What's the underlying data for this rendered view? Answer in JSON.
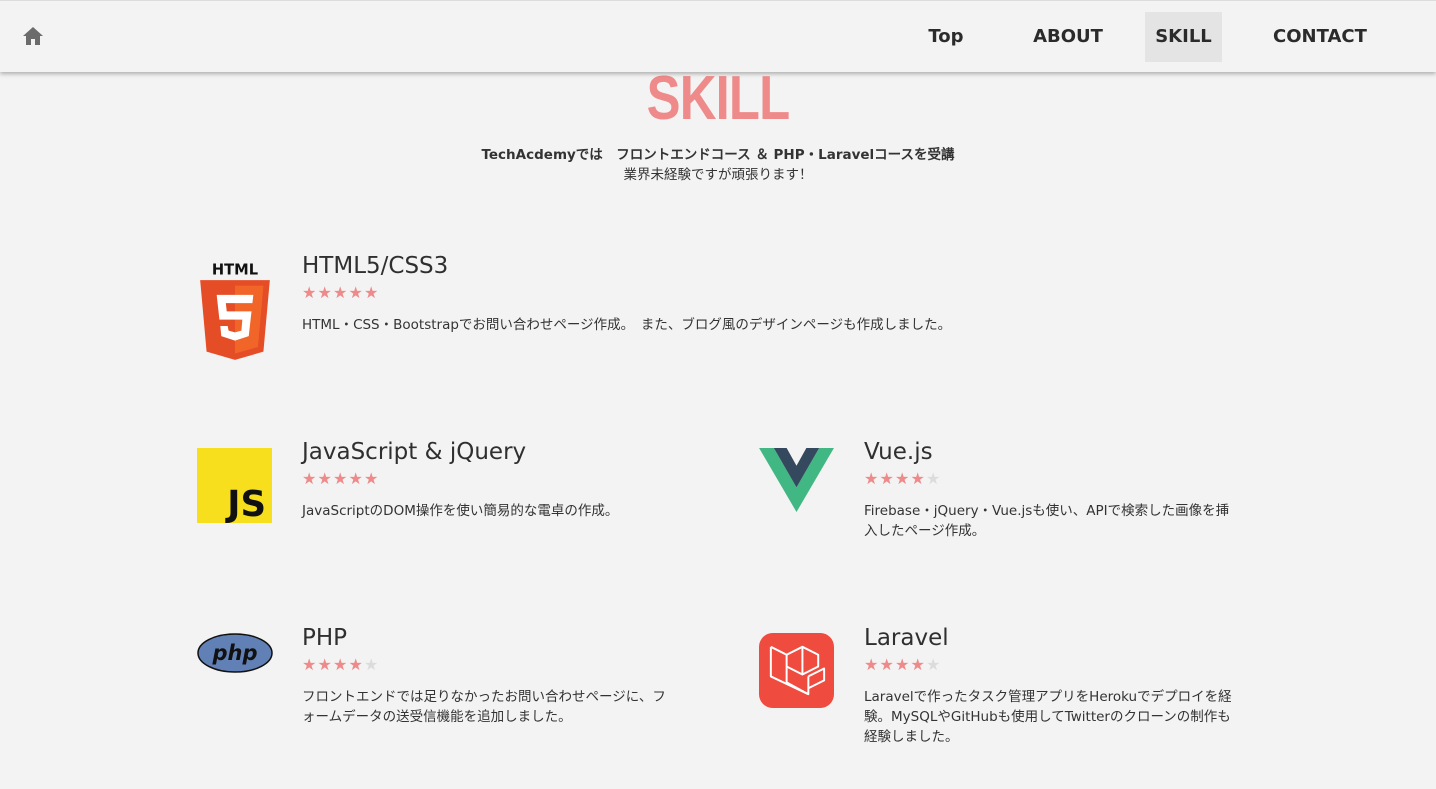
{
  "header": {
    "home_icon": "home-icon",
    "nav": [
      {
        "label": "Top",
        "active": false
      },
      {
        "label": "ABOUT",
        "active": false
      },
      {
        "label": "SKILL",
        "active": true
      },
      {
        "label": "CONTACT",
        "active": false
      }
    ]
  },
  "section": {
    "title": "SKILL",
    "intro_line1": "TechAcdemyでは　フロントエンドコース ＆ PHP・Laravelコースを受講",
    "intro_line2": "業界未経験ですが頑張ります！"
  },
  "colors": {
    "accent": "#ee8a8a",
    "background": "#f3f3f3",
    "star_off": "#dcdcdc"
  },
  "skills": [
    {
      "name": "HTML5/CSS3",
      "logo": "html5-logo",
      "logo_text": "HTML",
      "rating": 5,
      "max_rating": 5,
      "description": "HTML・CSS・Bootstrapでお問い合わせページ作成。　また、ブログ風のデザインページも作成しました。"
    },
    {
      "name": "JavaScript & jQuery",
      "logo": "javascript-logo",
      "logo_text": "JS",
      "rating": 5,
      "max_rating": 5,
      "description": "JavaScriptのDOM操作を使い簡易的な電卓の作成。"
    },
    {
      "name": "Vue.js",
      "logo": "vuejs-logo",
      "rating": 4,
      "max_rating": 5,
      "description": "Firebase・jQuery・Vue.jsも使い、APIで検索した画像を挿入したページ作成。"
    },
    {
      "name": "PHP",
      "logo": "php-logo",
      "logo_text": "php",
      "rating": 4,
      "max_rating": 5,
      "description": "フロントエンドでは足りなかったお問い合わせページに、フォームデータの送受信機能を追加しました。"
    },
    {
      "name": "Laravel",
      "logo": "laravel-logo",
      "rating": 4,
      "max_rating": 5,
      "description": "Laravelで作ったタスク管理アプリをHerokuでデプロイを経験。MySQLやGitHubも使用してTwitterのクローンの制作も経験しました。"
    }
  ]
}
